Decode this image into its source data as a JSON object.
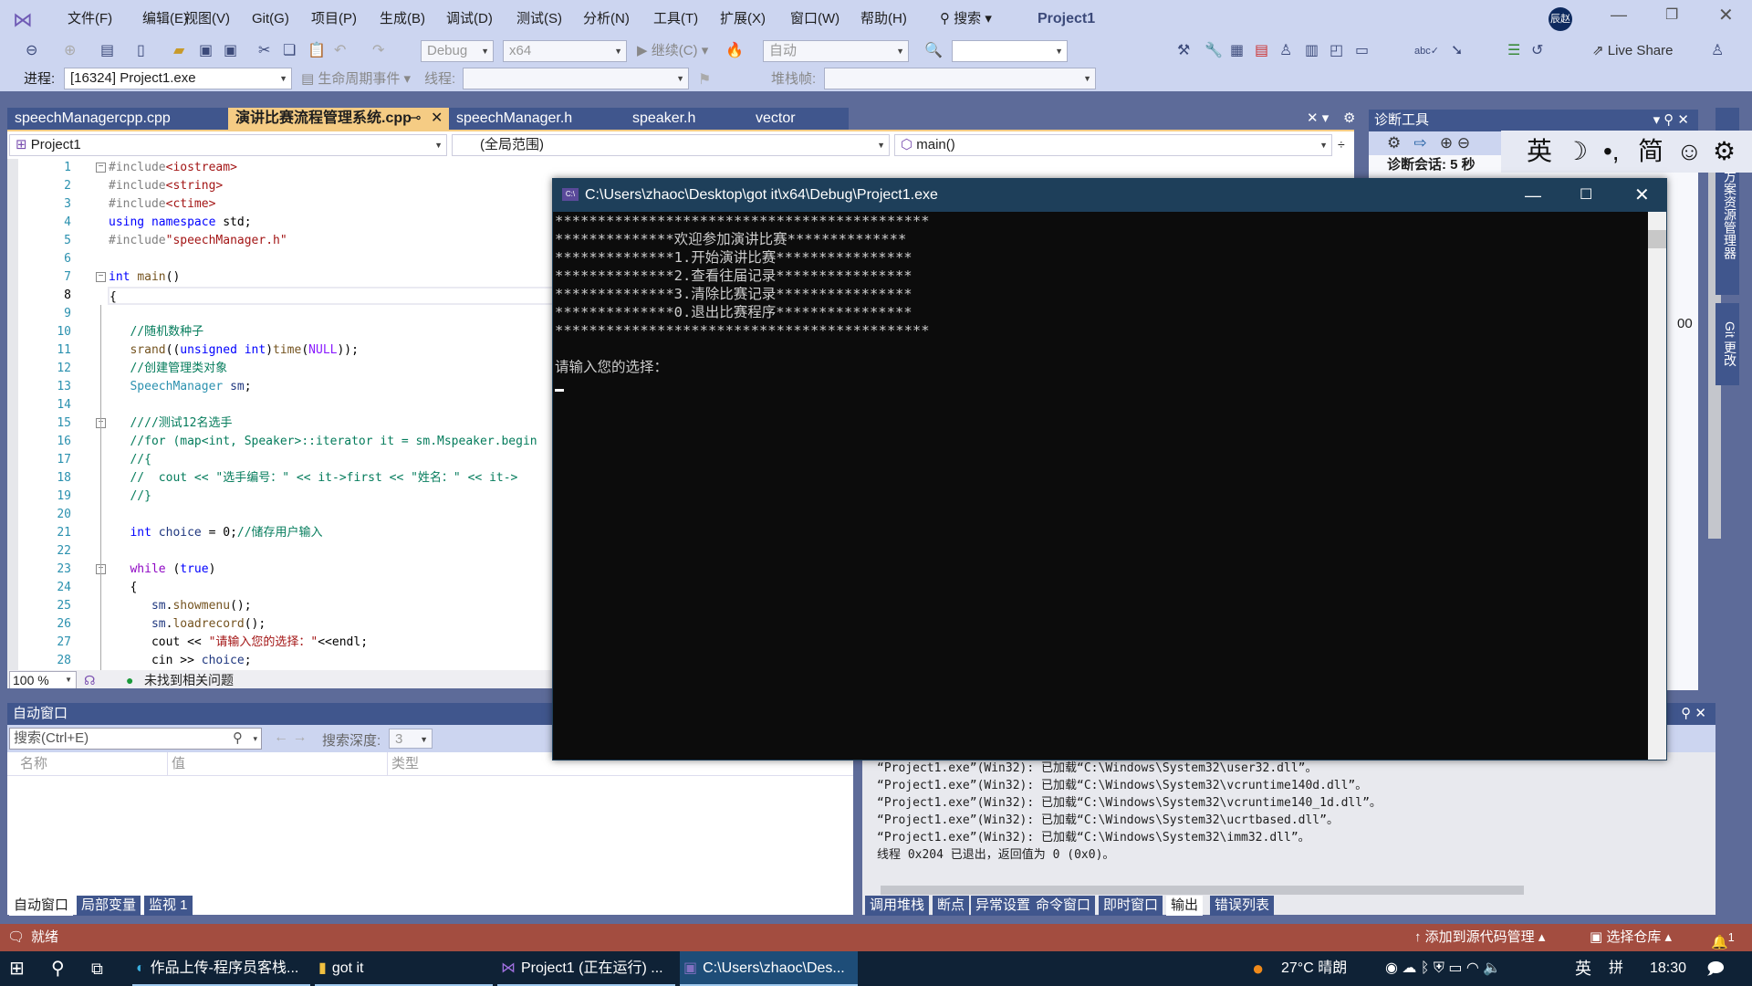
{
  "menu": {
    "items": [
      "文件(F)",
      "编辑(E)",
      "视图(V)",
      "Git(G)",
      "项目(P)",
      "生成(B)",
      "调试(D)",
      "测试(S)",
      "分析(N)",
      "工具(T)",
      "扩展(X)",
      "窗口(W)",
      "帮助(H)"
    ],
    "search": "搜索",
    "title": "Project1",
    "avatar": "辰赵"
  },
  "toolbar": {
    "config": "Debug",
    "platform": "x64",
    "continue": "继续(C)",
    "auto": "自动",
    "live_share": "Live Share",
    "process_label": "进程:",
    "process": "[16324] Project1.exe",
    "lifecycle": "生命周期事件",
    "thread_label": "线程:",
    "stack_label": "堆栈帧:"
  },
  "tabs": [
    {
      "label": "speechManagercpp.cpp"
    },
    {
      "label": "演讲比赛流程管理系统.cpp",
      "active": true
    },
    {
      "label": "speechManager.h"
    },
    {
      "label": "speaker.h"
    },
    {
      "label": "vector"
    }
  ],
  "nav": {
    "project": "Project1",
    "scope": "(全局范围)",
    "member": "main()"
  },
  "code": [
    [
      [
        "#include",
        "pp"
      ],
      [
        "<iostream>",
        "str"
      ]
    ],
    [
      [
        "#include",
        "pp"
      ],
      [
        "<string>",
        "str"
      ]
    ],
    [
      [
        "#include",
        "pp"
      ],
      [
        "<ctime>",
        "str"
      ]
    ],
    [
      [
        "using namespace",
        "kw"
      ],
      [
        " std;",
        ""
      ]
    ],
    [
      [
        "#include",
        "pp"
      ],
      [
        "\"speechManager.h\"",
        "str"
      ]
    ],
    [],
    [
      [
        "int",
        "kw"
      ],
      [
        " ",
        ""
      ],
      [
        "main",
        "fn"
      ],
      [
        "()",
        ""
      ]
    ],
    [
      [
        "{",
        ""
      ]
    ],
    [],
    [
      [
        "   //随机数种子",
        "cm"
      ]
    ],
    [
      [
        "   ",
        ""
      ],
      [
        "srand",
        "fn"
      ],
      [
        "((",
        ""
      ],
      [
        "unsigned int",
        "kw"
      ],
      [
        ")",
        ""
      ],
      [
        "time",
        "fn"
      ],
      [
        "(",
        ""
      ],
      [
        "NULL",
        "mac"
      ],
      [
        "));",
        ""
      ]
    ],
    [
      [
        "   //创建管理类对象",
        "cm"
      ]
    ],
    [
      [
        "   ",
        ""
      ],
      [
        "SpeechManager",
        "ty"
      ],
      [
        " ",
        ""
      ],
      [
        "sm",
        "var"
      ],
      [
        ";",
        ""
      ]
    ],
    [],
    [
      [
        "   ////测试12名选手",
        "cm"
      ]
    ],
    [
      [
        "   //for (map<int, Speaker>::iterator it = sm.Mspeaker.begin",
        "cm"
      ]
    ],
    [
      [
        "   //{",
        "cm"
      ]
    ],
    [
      [
        "   //  cout << \"选手编号：\" << it->first << \"姓名：\" << it->",
        "cm"
      ]
    ],
    [
      [
        "   //}",
        "cm"
      ]
    ],
    [],
    [
      [
        "   ",
        ""
      ],
      [
        "int",
        "kw"
      ],
      [
        " ",
        ""
      ],
      [
        "choice",
        "var"
      ],
      [
        " = 0;",
        ""
      ],
      [
        "//储存用户输入",
        "cm"
      ]
    ],
    [],
    [
      [
        "   ",
        ""
      ],
      [
        "while",
        "ctl"
      ],
      [
        " (",
        ""
      ],
      [
        "true",
        "kw"
      ],
      [
        ")",
        ""
      ]
    ],
    [
      [
        "   {",
        ""
      ]
    ],
    [
      [
        "      ",
        ""
      ],
      [
        "sm",
        "var"
      ],
      [
        ".",
        ""
      ],
      [
        "showmenu",
        "fn"
      ],
      [
        "();",
        ""
      ]
    ],
    [
      [
        "      ",
        ""
      ],
      [
        "sm",
        "var"
      ],
      [
        ".",
        ""
      ],
      [
        "loadrecord",
        "fn"
      ],
      [
        "();",
        ""
      ]
    ],
    [
      [
        "      cout << ",
        ""
      ],
      [
        "\"请输入您的选择：\"",
        "str"
      ],
      [
        "<<endl;",
        ""
      ]
    ],
    [
      [
        "      cin >> ",
        ""
      ],
      [
        "choice",
        "var"
      ],
      [
        ";",
        ""
      ]
    ]
  ],
  "current_line": 8,
  "editor_status": {
    "zoom": "100 %",
    "issues": "未找到相关问题"
  },
  "diag": {
    "title": "诊断工具",
    "session": "诊断会话: 5 秒",
    "partial": "00"
  },
  "side_tabs": [
    "解决方案资源管理器",
    "Git 更改"
  ],
  "ime": {
    "lang": "英",
    "moon": "☽",
    "punct": "•,",
    "simp": "简",
    "emoji": "☺",
    "settings": "⚙"
  },
  "console": {
    "title": "C:\\Users\\zhaoc\\Desktop\\got it\\x64\\Debug\\Project1.exe",
    "lines": [
      "********************************************",
      "**************欢迎参加演讲比赛**************",
      "**************1.开始演讲比赛****************",
      "**************2.查看往届记录****************",
      "**************3.清除比赛记录****************",
      "**************0.退出比赛程序****************",
      "********************************************",
      "",
      "请输入您的选择："
    ]
  },
  "autos": {
    "title": "自动窗口",
    "search_placeholder": "搜索(Ctrl+E)",
    "depth_label": "搜索深度:",
    "depth": "3",
    "columns": [
      "名称",
      "值",
      "类型"
    ],
    "tabs": [
      "自动窗口",
      "局部变量",
      "监视 1"
    ]
  },
  "output": {
    "lines": [
      "“Project1.exe”(Win32): 已加载“C:\\Windows\\System32\\user32.dll”。",
      "“Project1.exe”(Win32): 已加载“C:\\Windows\\System32\\vcruntime140d.dll”。",
      "“Project1.exe”(Win32): 已加载“C:\\Windows\\System32\\vcruntime140_1d.dll”。",
      "“Project1.exe”(Win32): 已加载“C:\\Windows\\System32\\ucrtbased.dll”。",
      "“Project1.exe”(Win32): 已加载“C:\\Windows\\System32\\imm32.dll”。",
      "线程 0x204 已退出，返回值为 0 (0x0)。"
    ],
    "tabs": [
      "调用堆栈",
      "断点",
      "异常设置",
      "命令窗口",
      "即时窗口",
      "输出",
      "错误列表"
    ],
    "active_tab": "输出"
  },
  "status": {
    "ready": "就绪",
    "add_source": "添加到源代码管理",
    "repo": "选择仓库",
    "notifications": "1"
  },
  "taskbar": {
    "items": [
      "作品上传-程序员客栈...",
      "got it",
      "Project1 (正在运行) ...",
      "C:\\Users\\zhaoc\\Des..."
    ],
    "weather": "27°C 晴朗",
    "lang": "英",
    "ime": "拼",
    "time": "18:30"
  },
  "colors": {
    "accent_tab": "#f5cc84",
    "status_bar": "#a34d40",
    "panel_header": "#40568d",
    "console_title": "#1e3f5a"
  }
}
